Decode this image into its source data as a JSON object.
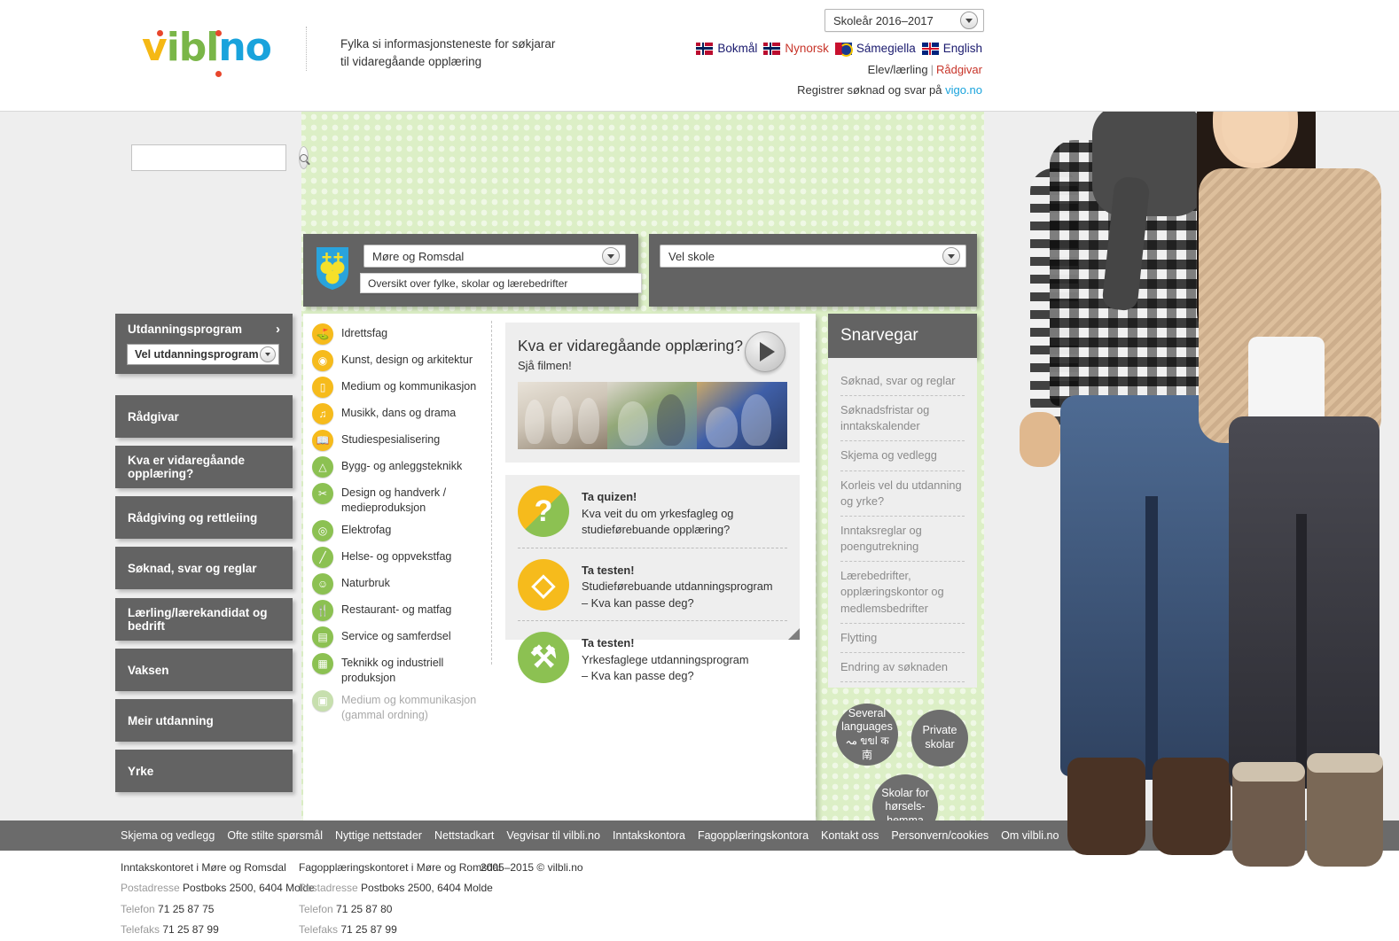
{
  "header": {
    "logo_parts": [
      "v",
      "ibl",
      "no"
    ],
    "tagline_line1": "Fylka si informasjonsteneste for søkjarar",
    "tagline_line2": "til vidaregåande opplæring",
    "year_select": "Skoleår 2016–2017",
    "languages": [
      {
        "label": "Bokmål",
        "flag": "norway-flag-icon",
        "active": false
      },
      {
        "label": "Nynorsk",
        "flag": "norway-flag-icon",
        "active": true
      },
      {
        "label": "Sámegiella",
        "flag": "sami-flag-icon",
        "active": false
      },
      {
        "label": "English",
        "flag": "uk-flag-icon",
        "active": false
      }
    ],
    "user_roles": {
      "elev": "Elev/lærling",
      "separator": "|",
      "radgivar": "Rådgivar"
    },
    "register_text": "Registrer søknad og svar på",
    "register_link": "vigo.no"
  },
  "search": {
    "value": "",
    "placeholder": ""
  },
  "sidebar": {
    "education_header": "Utdanningsprogram",
    "education_select": "Vel utdanningsprogram",
    "items": [
      {
        "label": "Rådgivar"
      },
      {
        "label": "Kva er vidaregåande opplæring?"
      },
      {
        "label": "Rådgiving og rettleiing"
      },
      {
        "label": "Søknad, svar og reglar"
      },
      {
        "label": "Lærling/lærekandidat og bedrift"
      },
      {
        "label": "Vaksen"
      },
      {
        "label": "Meir utdanning"
      },
      {
        "label": "Yrke"
      }
    ]
  },
  "selectors": {
    "county": "Møre og Romsdal",
    "county_hint": "Oversikt over fylke, skolar og lærebedrifter",
    "school": "Vel skole"
  },
  "programs": [
    {
      "label": "Idrettsfag",
      "color": "yellow",
      "icon": "sports-icon"
    },
    {
      "label": "Kunst, design og arkitektur",
      "color": "yellow",
      "icon": "palette-icon"
    },
    {
      "label": "Medium og kommunikasjon",
      "color": "yellow",
      "icon": "monitor-icon"
    },
    {
      "label": "Musikk, dans og drama",
      "color": "yellow",
      "icon": "music-note-icon"
    },
    {
      "label": "Studiespesialisering",
      "color": "yellow",
      "icon": "book-icon"
    },
    {
      "label": "Bygg- og anleggsteknikk",
      "color": "green",
      "icon": "hardhat-icon"
    },
    {
      "label": "Design og handverk / medieproduksjon",
      "color": "green",
      "icon": "scissors-icon"
    },
    {
      "label": "Elektrofag",
      "color": "green",
      "icon": "plug-icon"
    },
    {
      "label": "Helse- og oppvekstfag",
      "color": "green",
      "icon": "bandage-icon"
    },
    {
      "label": "Naturbruk",
      "color": "green",
      "icon": "cow-icon"
    },
    {
      "label": "Restaurant- og matfag",
      "color": "green",
      "icon": "cutlery-icon"
    },
    {
      "label": "Service og samferdsel",
      "color": "green",
      "icon": "truck-icon"
    },
    {
      "label": "Teknikk og industriell produksjon",
      "color": "green",
      "icon": "factory-icon"
    },
    {
      "label": "Medium og kommunikasjon (gammal ordning)",
      "color": "grey",
      "icon": "camera-icon",
      "dimmed": true
    }
  ],
  "video": {
    "title": "Kva er vidaregåande opplæring?",
    "subtitle": "Sjå filmen!",
    "play_icon": "play-icon"
  },
  "quizzes": [
    {
      "title": "Ta quizen!",
      "line1": "Kva veit du om yrkesfagleg og",
      "line2": "studieførebuande opplæring?",
      "icon": "question-mark-icon"
    },
    {
      "title": "Ta testen!",
      "line1": "Studieførebuande utdanningsprogram",
      "line2": "– Kva kan passe deg?",
      "icon": "shapes-icon"
    },
    {
      "title": "Ta testen!",
      "line1": "Yrkesfaglege utdanningsprogram",
      "line2": "– Kva kan passe deg?",
      "icon": "tools-icon"
    }
  ],
  "shortcuts": {
    "header": "Snarvegar",
    "items": [
      "Søknad, svar og reglar",
      "Søknadsfristar og inntakskalender",
      "Skjema og vedlegg",
      "Korleis vel du utdanning og yrke?",
      "Inntaksreglar og poengutrekning",
      "Lærebedrifter, opplæringskontor og medlemsbedrifter",
      "Flytting",
      "Endring av søknaden"
    ]
  },
  "circle_buttons": [
    {
      "line1": "Several",
      "line2": "languages",
      "line3": "مہ ขขا क 南"
    },
    {
      "line1": "Private",
      "line2": "skolar",
      "line3": ""
    },
    {
      "line1": "Skolar for",
      "line2": "hørsels-",
      "line3": "hemma"
    }
  ],
  "footer": {
    "links": [
      "Skjema og vedlegg",
      "Ofte stilte spørsmål",
      "Nyttige nettstader",
      "Nettstadkart",
      "Vegvisar til vilbli.no",
      "Inntakskontora",
      "Fagopplæringskontora",
      "Kontakt oss",
      "Personvern/cookies",
      "Om vilbli.no"
    ],
    "office1": {
      "title": "Inntakskontoret i Møre og Romsdal",
      "address_key": "Postadresse",
      "address_val": "Postboks 2500, 6404 Molde",
      "phone_key": "Telefon",
      "phone_val": "71 25 87 75",
      "fax_key": "Telefaks",
      "fax_val": "71 25 87 99"
    },
    "office2": {
      "title": "Fagopplæringskontoret i Møre og Romsdal",
      "address_key": "Postadresse",
      "address_val": "Postboks 2500, 6404 Molde",
      "phone_key": "Telefon",
      "phone_val": "71 25 87 80",
      "fax_key": "Telefaks",
      "fax_val": "71 25 87 99"
    },
    "copyright": "2005–2015 © vilbli.no"
  }
}
